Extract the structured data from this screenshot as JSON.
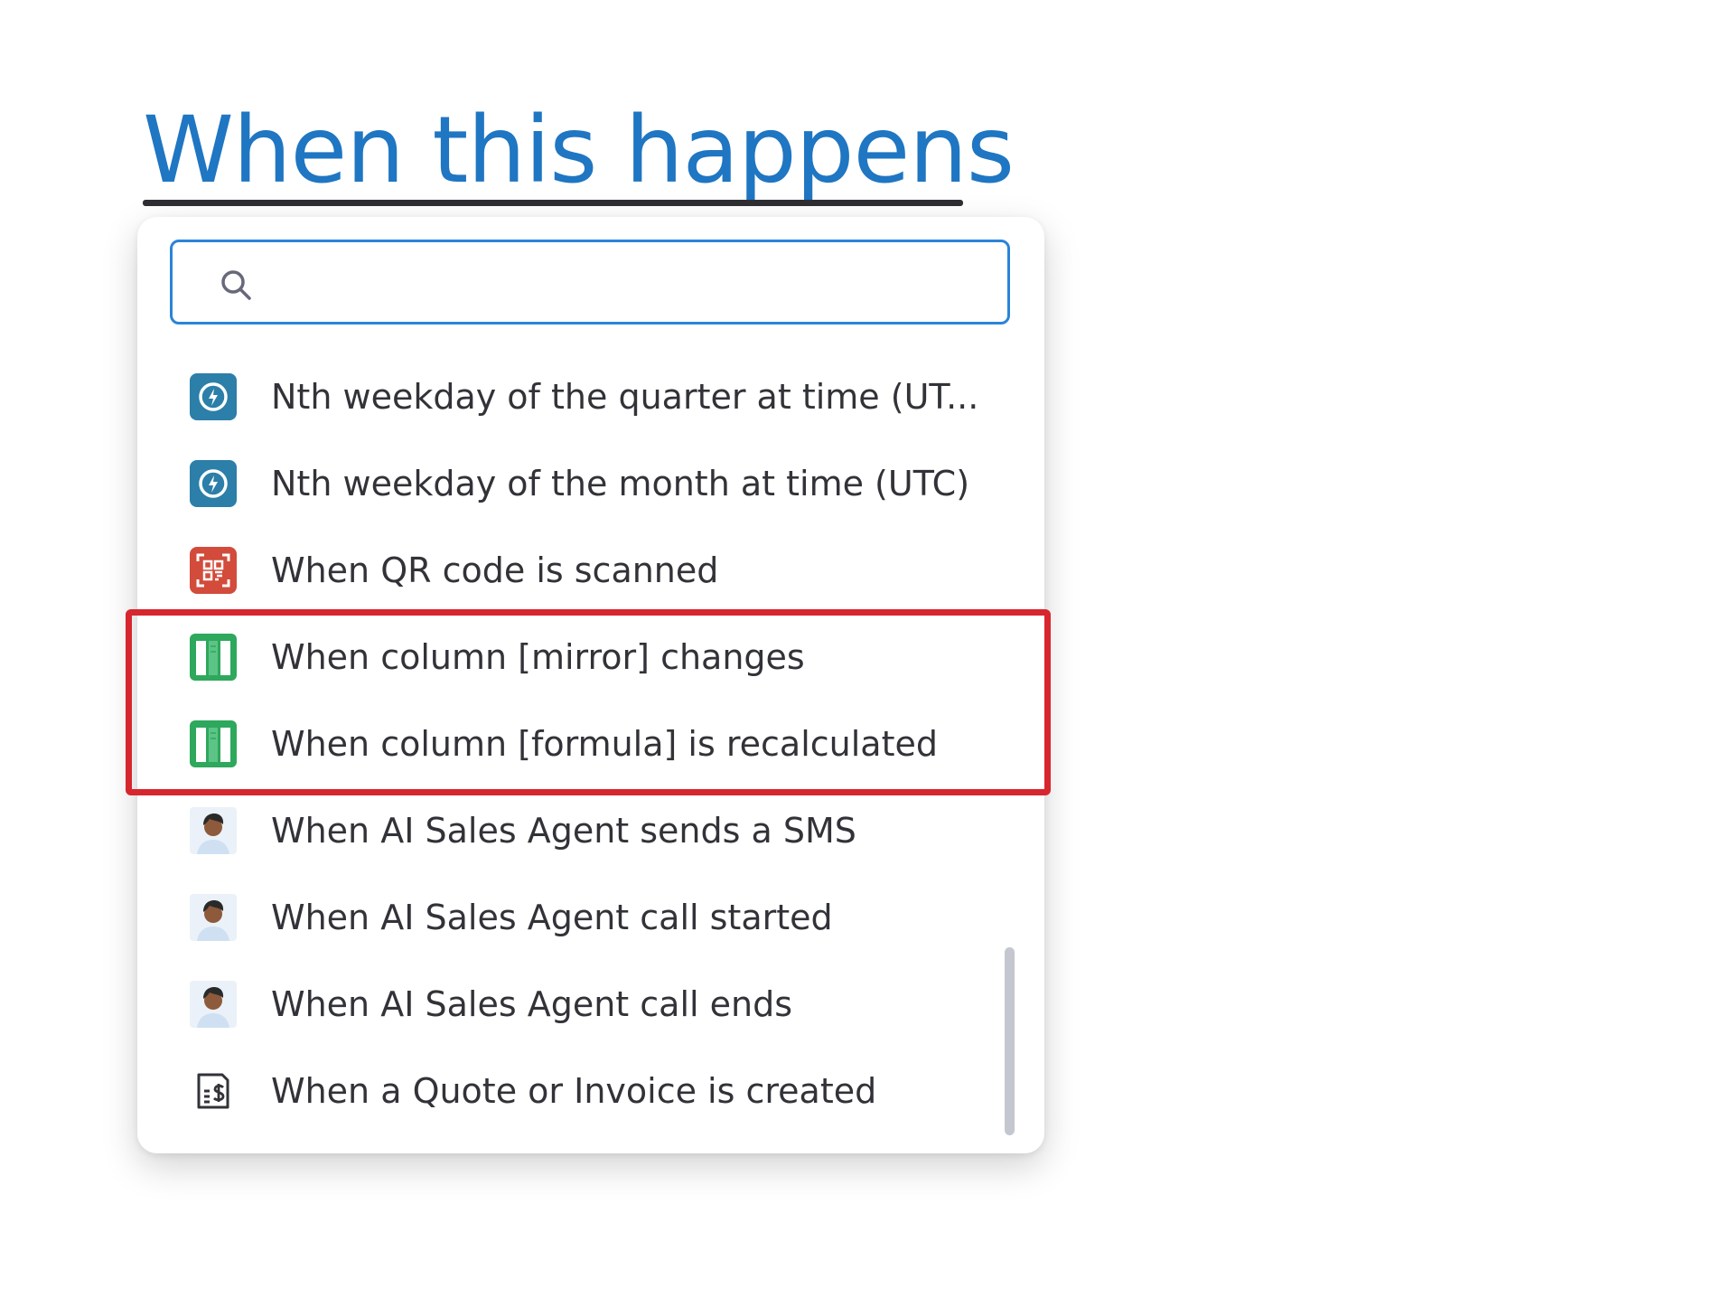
{
  "header": {
    "title": "When this happens"
  },
  "search": {
    "value": "",
    "placeholder": ""
  },
  "triggers": [
    {
      "label": "Nth weekday of the quarter at time (UT...",
      "icon": "clock-icon"
    },
    {
      "label": "Nth weekday of the month at time (UTC)",
      "icon": "clock-icon"
    },
    {
      "label": "When QR code is scanned",
      "icon": "qr-code-icon"
    },
    {
      "label": "When column [mirror] changes",
      "icon": "column-icon"
    },
    {
      "label": "When column [formula] is recalculated",
      "icon": "column-icon"
    },
    {
      "label": "When AI Sales Agent sends a SMS",
      "icon": "agent-avatar-icon"
    },
    {
      "label": "When AI Sales Agent call started",
      "icon": "agent-avatar-icon"
    },
    {
      "label": "When AI Sales Agent call ends",
      "icon": "agent-avatar-icon"
    },
    {
      "label": "When a Quote or Invoice is created",
      "icon": "invoice-icon"
    }
  ],
  "colors": {
    "heading": "#1f76c2",
    "search_border": "#2a84d9",
    "clock_tile": "#2b7fa8",
    "qr_tile": "#d24b3b",
    "column_tile": "#2ea85c",
    "highlight": "#d7262e"
  }
}
